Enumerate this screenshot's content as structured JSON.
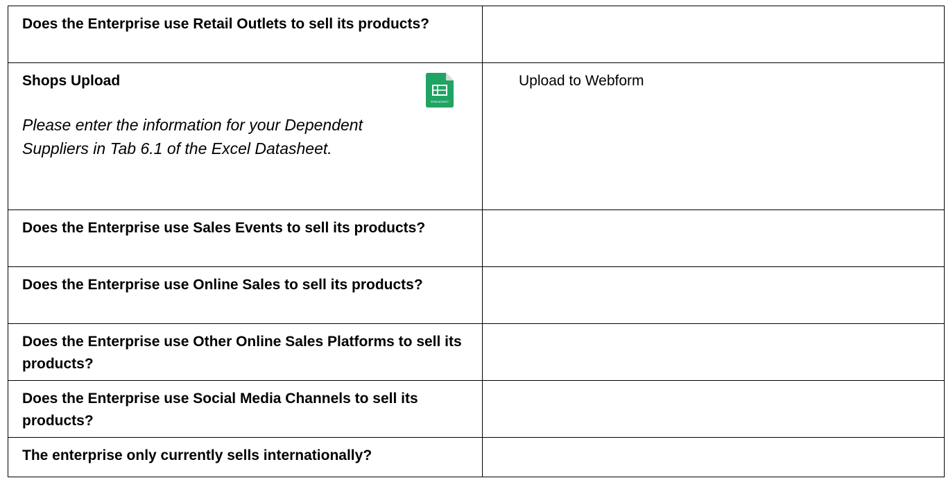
{
  "rows": [
    {
      "question": "Does the Enterprise use Retail Outlets to sell its products?",
      "answer": ""
    },
    {
      "title": "Shops Upload",
      "note": "Please enter the information for your Dependent Suppliers in Tab 6.1 of the Excel Datasheet.",
      "icon": "spreadsheet-icon",
      "icon_label": "SPREADSHEET",
      "icon_color": "#1fa463",
      "answer": "Upload to Webform"
    },
    {
      "question": "Does the Enterprise use Sales Events to sell its products?",
      "answer": ""
    },
    {
      "question": "Does the Enterprise use Online Sales to sell its products?",
      "answer": ""
    },
    {
      "question": "Does the Enterprise use Other Online Sales Platforms to sell its products?",
      "answer": ""
    },
    {
      "question": "Does the Enterprise use Social Media Channels to sell its products?",
      "answer": ""
    },
    {
      "question": "The enterprise only currently sells internationally?",
      "answer": ""
    }
  ]
}
